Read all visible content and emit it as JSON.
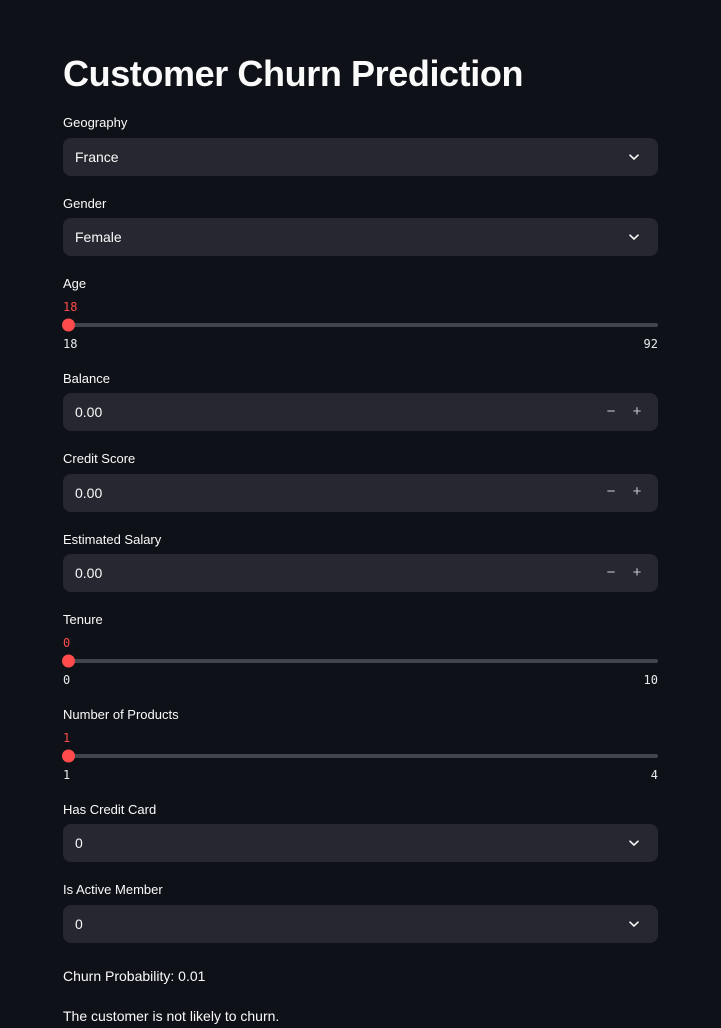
{
  "app": {
    "title": "Customer Churn Prediction",
    "accent_color": "#FF4B4B",
    "background_color": "#0E1117",
    "widget_background_color": "#262730",
    "text_color": "#FAFAFA",
    "track_color": "#43454E"
  },
  "fields": {
    "geography": {
      "label": "Geography",
      "value": "France",
      "icon": "chevron-down-icon"
    },
    "gender": {
      "label": "Gender",
      "value": "Female",
      "icon": "chevron-down-icon"
    },
    "age": {
      "label": "Age",
      "value": "18",
      "min": "18",
      "max": "92",
      "fill_percent": 0
    },
    "balance": {
      "label": "Balance",
      "value": "0.00",
      "decrement": "−",
      "increment": "+"
    },
    "credit_score": {
      "label": "Credit Score",
      "value": "0.00",
      "decrement": "−",
      "increment": "+"
    },
    "estimated_salary": {
      "label": "Estimated Salary",
      "value": "0.00",
      "decrement": "−",
      "increment": "+"
    },
    "tenure": {
      "label": "Tenure",
      "value": "0",
      "min": "0",
      "max": "10",
      "fill_percent": 0
    },
    "number_of_products": {
      "label": "Number of Products",
      "value": "1",
      "min": "1",
      "max": "4",
      "fill_percent": 0
    },
    "has_credit_card": {
      "label": "Has Credit Card",
      "value": "0",
      "icon": "chevron-down-icon"
    },
    "is_active_member": {
      "label": "Is Active Member",
      "value": "0",
      "icon": "chevron-down-icon"
    }
  },
  "result": {
    "probability_line": "Churn Probability: 0.01",
    "verdict_line": "The customer is not likely to churn."
  }
}
